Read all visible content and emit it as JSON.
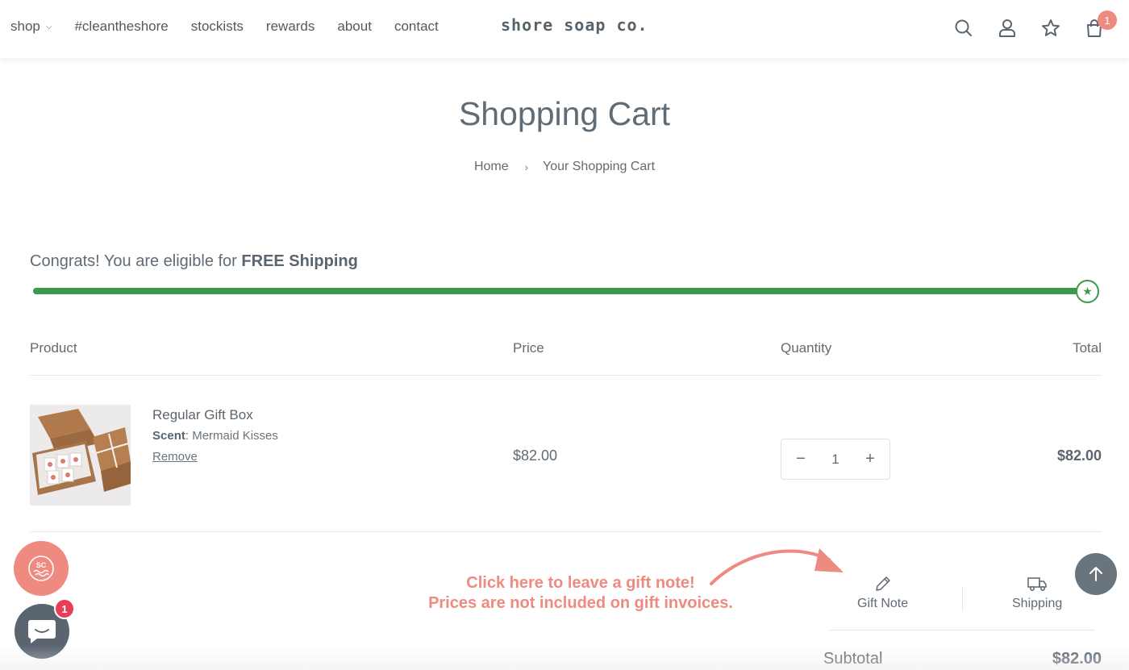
{
  "nav": {
    "items": [
      {
        "label": "shop",
        "has_dropdown": true
      },
      {
        "label": "#cleantheshore"
      },
      {
        "label": "stockists"
      },
      {
        "label": "rewards"
      },
      {
        "label": "about"
      },
      {
        "label": "contact"
      }
    ]
  },
  "brand": {
    "logo_text": "shore soap co."
  },
  "header_icons": {
    "search": "search-icon",
    "account": "user-icon",
    "wishlist": "star-icon",
    "cart": "shopping-bag-icon",
    "cart_count": "1"
  },
  "page": {
    "title": "Shopping Cart",
    "breadcrumb": {
      "home": "Home",
      "separator": "›",
      "current": "Your Shopping Cart"
    }
  },
  "shipping": {
    "message_prefix": "Congrats! You are eligible for",
    "message_bold": "FREE Shipping",
    "progress": 1.0,
    "color": "#3a9a4a"
  },
  "table": {
    "headers": {
      "product": "Product",
      "price": "Price",
      "quantity": "Quantity",
      "total": "Total"
    }
  },
  "cart_item": {
    "name": "Regular Gift Box",
    "variant_label": "Scent",
    "variant_value": "Mermaid Kisses",
    "remove_label": "Remove",
    "price": "$82.00",
    "quantity": "1",
    "total": "$82.00"
  },
  "annotation": {
    "line1": "Click here to leave a gift note!",
    "line2": "Prices are not included on gift invoices.",
    "color": "#ee8a7f"
  },
  "tools": {
    "gift_note": "Gift Note",
    "shipping": "Shipping"
  },
  "summary": {
    "subtotal_label": "Subtotal",
    "subtotal_value": "$82.00"
  },
  "floating": {
    "rewards_label": "SC",
    "chat_badge": "1"
  }
}
